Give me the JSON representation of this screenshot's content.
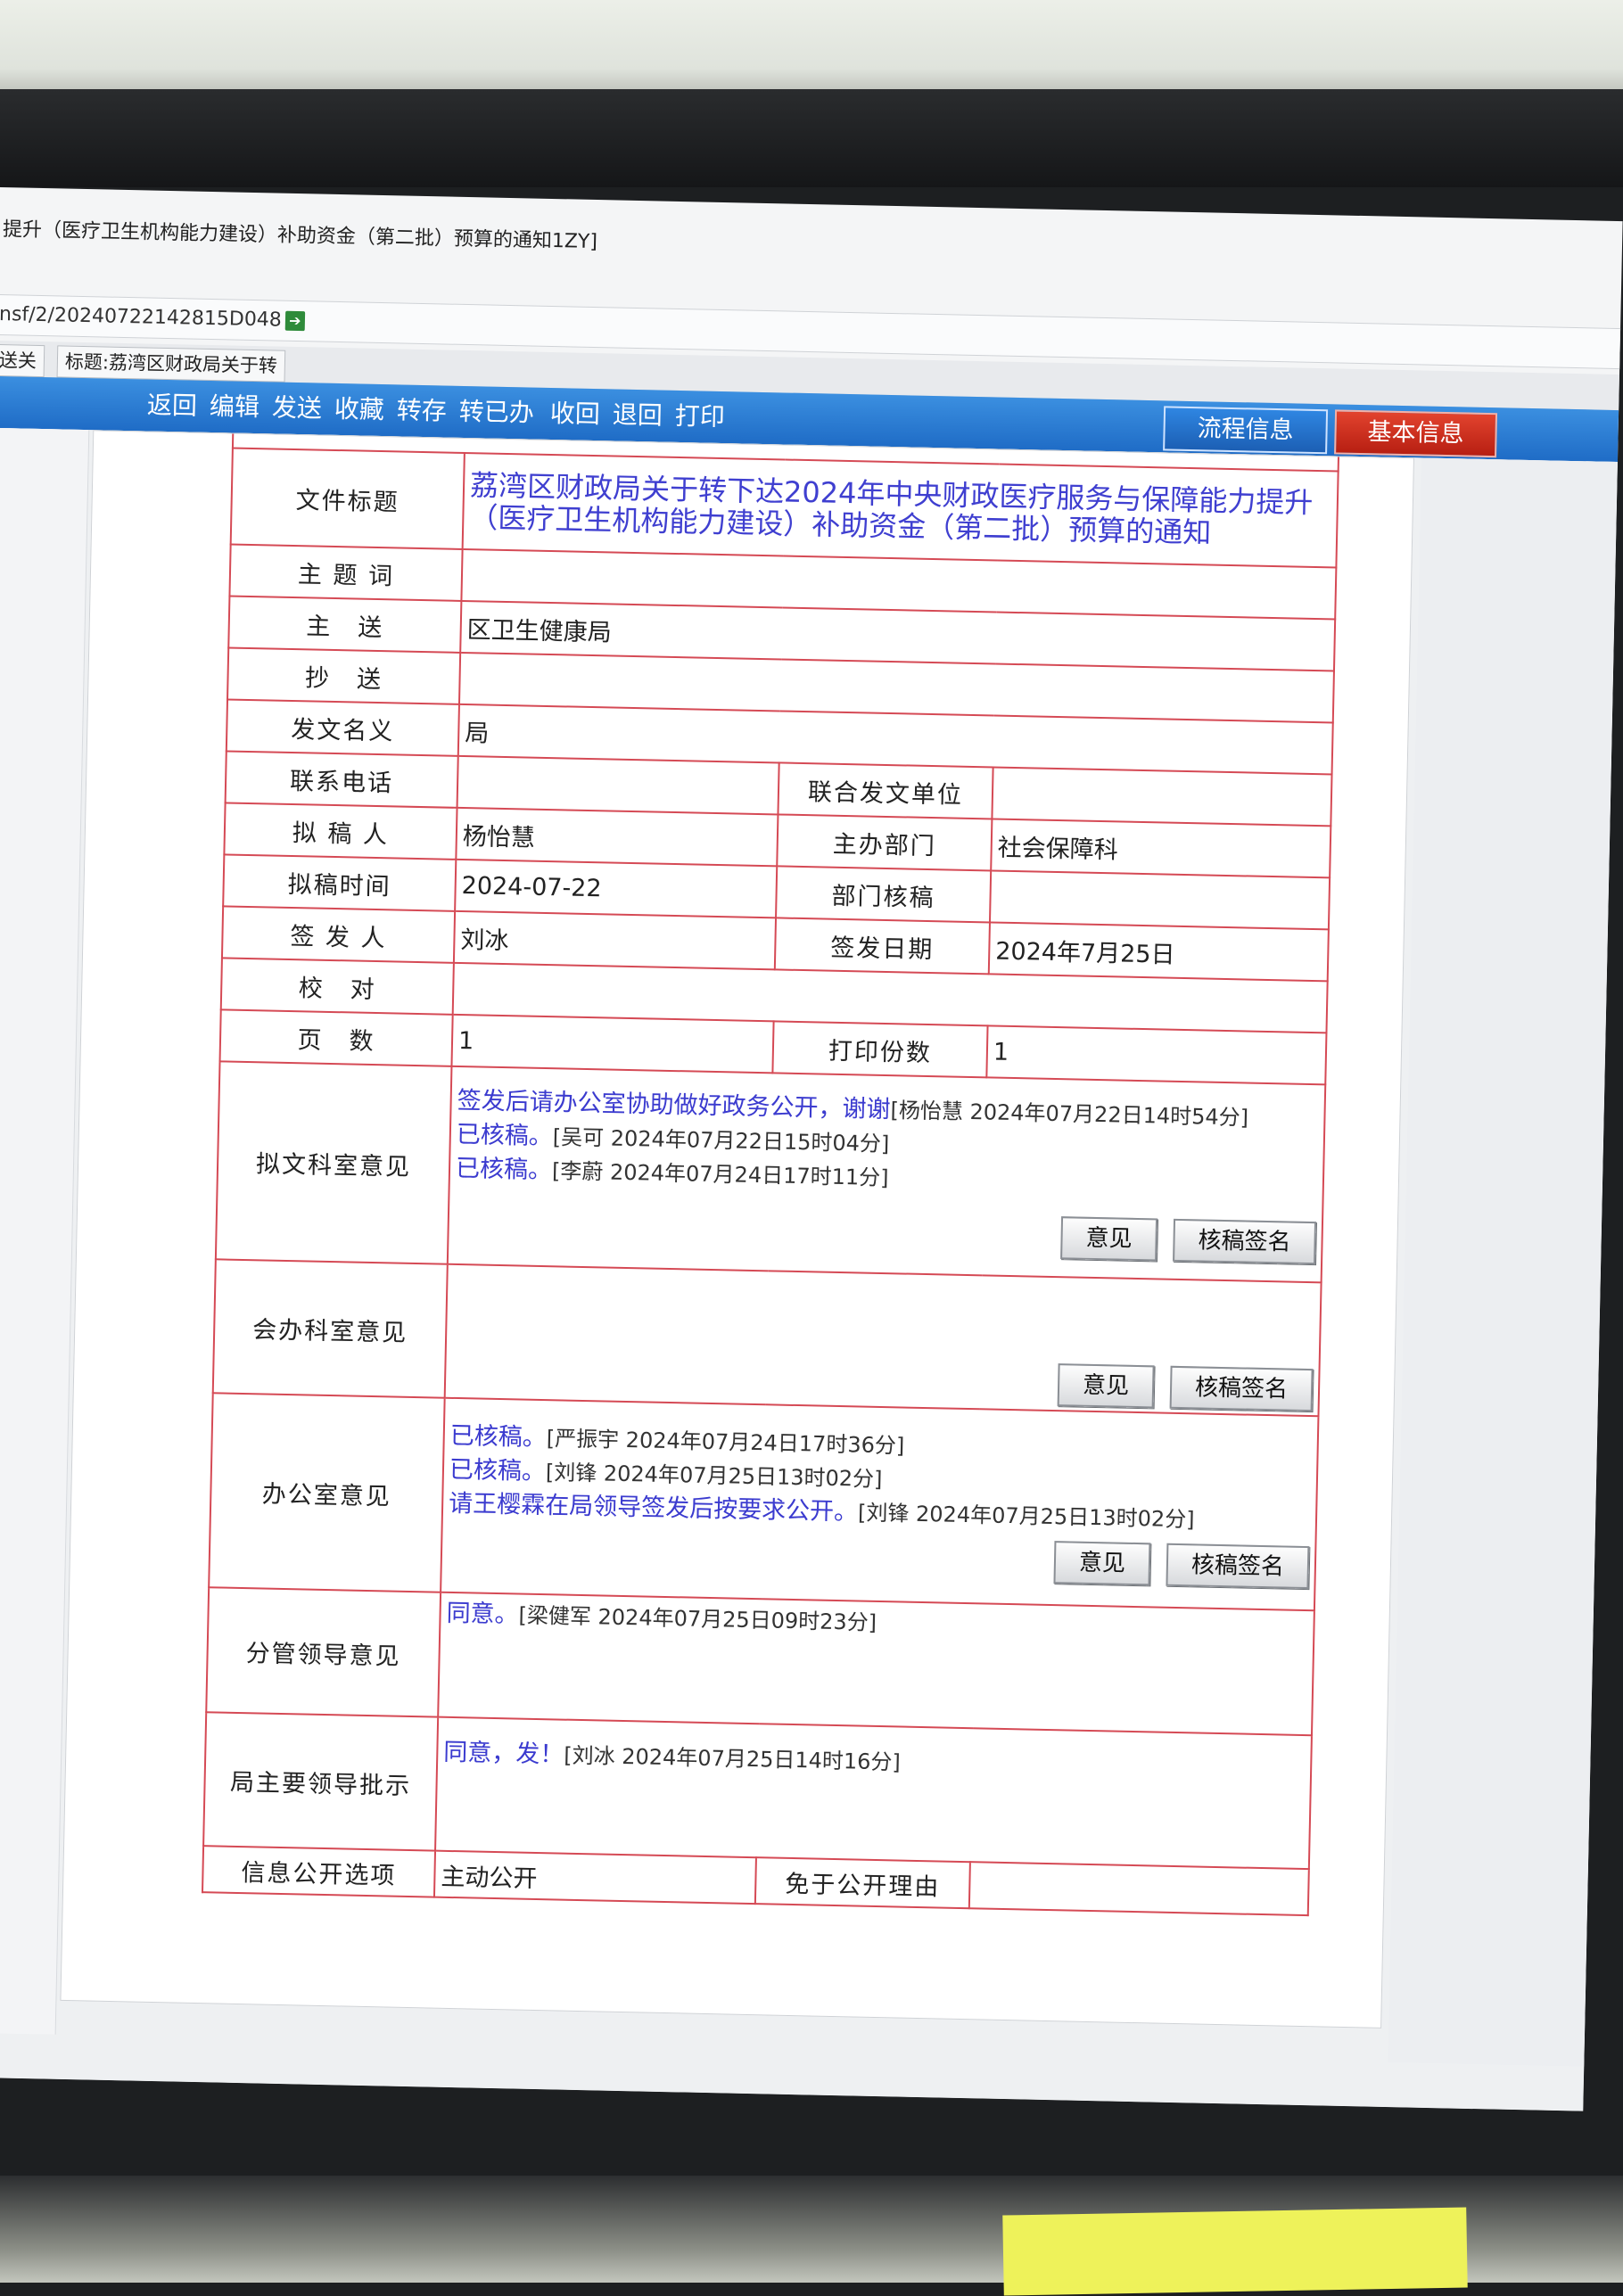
{
  "window": {
    "title": "提升（医疗卫生机构能力建设）补助资金（第二批）预算的通知1ZY]",
    "address": "nsf/2/20240722142815D048",
    "tabs": [
      "送关",
      "标题:荔湾区财政局关于转"
    ]
  },
  "toolbar": {
    "actions": [
      "返回",
      "编辑",
      "发送",
      "收藏",
      "转存",
      "转已办",
      "收回",
      "退回",
      "打印"
    ],
    "flow_info": "流程信息",
    "basic_info": "基本信息"
  },
  "form": {
    "labels": {
      "doc_title": "文件标题",
      "keywords": "主 题 词",
      "main_to": "主　送",
      "cc": "抄　送",
      "issuer_name": "发文名义",
      "phone": "联系电话",
      "joint_unit": "联合发文单位",
      "drafter": "拟 稿 人",
      "host_dept": "主办部门",
      "draft_time": "拟稿时间",
      "dept_review": "部门核稿",
      "signer": "签 发 人",
      "sign_date": "签发日期",
      "proofread": "校　对",
      "pages": "页　数",
      "print_copies": "打印份数",
      "drafting_dept_opinion": "拟文科室意见",
      "co_dept_opinion": "会办科室意见",
      "office_opinion": "办公室意见",
      "leader_opinion": "分管领导意见",
      "chief_instruction": "局主要领导批示",
      "disclosure": "信息公开选项",
      "exempt_reason": "免于公开理由"
    },
    "values": {
      "doc_title": "荔湾区财政局关于转下达2024年中央财政医疗服务与保障能力提升（医疗卫生机构能力建设）补助资金（第二批）预算的通知",
      "keywords": "",
      "main_to": "区卫生健康局",
      "cc": "",
      "issuer_name": "局",
      "phone": "",
      "joint_unit": "",
      "drafter": "杨怡慧",
      "host_dept": "社会保障科",
      "draft_time": "2024-07-22",
      "dept_review": "",
      "signer": "刘冰",
      "sign_date": "2024年7月25日",
      "proofread": "",
      "pages": "1",
      "print_copies": "1",
      "disclosure": "主动公开",
      "exempt_reason": ""
    },
    "opinions": {
      "drafting_dept": [
        {
          "text": "签发后请办公室协助做好政务公开，谢谢",
          "meta": "[杨怡慧 2024年07月22日14时54分]"
        },
        {
          "text": "已核稿。",
          "meta": "[吴可 2024年07月22日15时04分]"
        },
        {
          "text": "已核稿。",
          "meta": "[李蔚 2024年07月24日17时11分]"
        }
      ],
      "office": [
        {
          "text": "已核稿。",
          "meta": "[严振宇 2024年07月24日17时36分]"
        },
        {
          "text": "已核稿。",
          "meta": "[刘锋 2024年07月25日13时02分]"
        },
        {
          "text": "请王樱霖在局领导签发后按要求公开。",
          "meta": "[刘锋 2024年07月25日13时02分]"
        }
      ],
      "leader": [
        {
          "text": "同意。",
          "meta": "[梁健军 2024年07月25日09时23分]"
        }
      ],
      "chief": [
        {
          "text": "同意，发！",
          "meta": "[刘冰 2024年07月25日14时16分]"
        }
      ]
    },
    "buttons": {
      "opinion": "意见",
      "sign": "核稿签名"
    }
  }
}
